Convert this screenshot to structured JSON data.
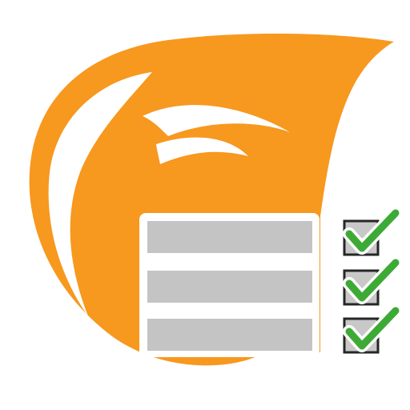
{
  "icon": {
    "kind": "flame-logo-with-checklist",
    "colors": {
      "flame": "#F7981F",
      "white": "#FFFFFF",
      "field_fill": "#C4C4C4",
      "checkbox_fill": "#C8C8C8",
      "checkbox_border": "#262626",
      "checkmark": "#3DAA35"
    },
    "rows": [
      {
        "name": "row-1",
        "checked": true
      },
      {
        "name": "row-2",
        "checked": true
      },
      {
        "name": "row-3",
        "checked": true
      }
    ]
  }
}
